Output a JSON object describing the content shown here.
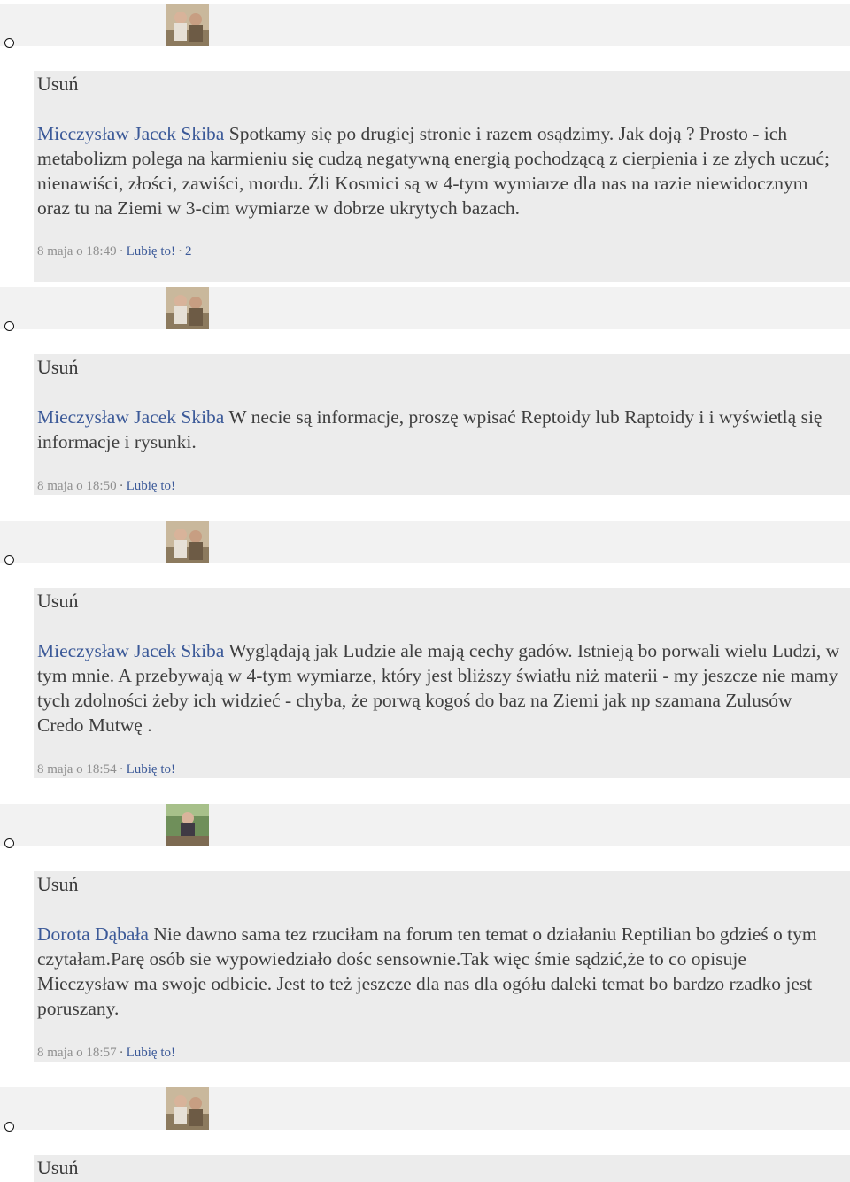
{
  "comments": [
    {
      "delete_label": "Usuń",
      "author": "Mieczysław Jacek Skiba",
      "text": " Spotkamy się po drugiej stronie i razem osądzimy. Jak doją ? Prosto - ich metabolizm polega na karmieniu się cudzą negatywną energią pochodzącą z cierpienia i ze złych uczuć; nienawiści, złości, zawiści, mordu. Źli Kosmici są w 4-tym wymiarze dla nas na razie niewidocznym oraz tu na Ziemi w 3-cim wymiarze w dobrze ukrytych bazach.",
      "timestamp": "8 maja o 18:49",
      "like_label": "Lubię to!",
      "likes": "2"
    },
    {
      "delete_label": "Usuń",
      "author": "Mieczysław Jacek Skiba",
      "text": " W necie są informacje, proszę wpisać Reptoidy lub Raptoidy i i wyświetlą się informacje i rysunki.",
      "timestamp": "8 maja o 18:50",
      "like_label": "Lubię to!"
    },
    {
      "delete_label": "Usuń",
      "author": "Mieczysław Jacek Skiba",
      "text": " Wyglądają jak Ludzie ale mają cechy gadów. Istnieją bo porwali wielu Ludzi, w tym mnie. A przebywają w 4-tym wymiarze, który jest bliższy światłu niż materii - my jeszcze nie mamy tych zdolności żeby ich widzieć - chyba, że porwą kogoś do baz na Ziemi jak np szamana Zulusów Credo Mutwę .",
      "timestamp": "8 maja o 18:54",
      "like_label": "Lubię to!"
    },
    {
      "delete_label": "Usuń",
      "author": "Dorota Dąbała",
      "text": " Nie dawno sama tez rzuciłam na forum ten temat o działaniu Reptilian bo gdzieś o tym czytałam.Parę osób sie wypowiedziało dośc sensownie.Tak więc śmie sądzić,że to co opisuje Mieczysław ma swoje odbicie. Jest to też jeszcze dla nas dla ogółu daleki temat bo bardzo rzadko jest poruszany.",
      "timestamp": "8 maja o 18:57",
      "like_label": "Lubię to!"
    },
    {
      "delete_label": "Usuń"
    }
  ],
  "colors": {
    "author_link": "#3b5998",
    "meta_text": "#8f8f8f",
    "comment_bg": "#ececec",
    "strip_bg": "#f2f2f2"
  },
  "icons": {
    "list_bullet": "circle-bullet-icon",
    "avatar": "user-avatar"
  }
}
